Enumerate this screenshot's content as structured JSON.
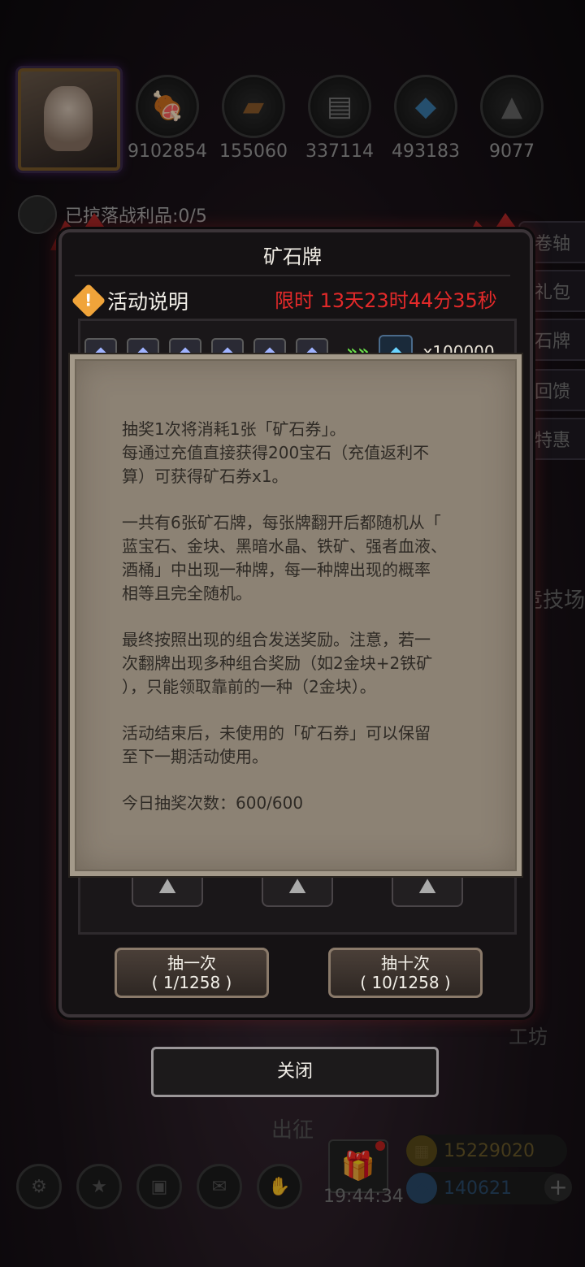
{
  "resources": [
    {
      "icon": "meat-icon",
      "value": "9102854"
    },
    {
      "icon": "wood-icon",
      "value": "155060"
    },
    {
      "icon": "iron-icon",
      "value": "337114"
    },
    {
      "icon": "crystal-icon",
      "value": "493183"
    },
    {
      "icon": "stone-icon",
      "value": "9077"
    }
  ],
  "loot_text": "已掠落战利品:0/5",
  "side_buttons": [
    "卷轴",
    "礼包",
    "石牌",
    "回馈",
    "特惠"
  ],
  "arena_label": "竞技场",
  "workshop_label": "工坊",
  "expedition_label": "出征",
  "panel": {
    "title": "矿石牌",
    "info_label": "活动说明",
    "timer": "限时 13天23时44分35秒",
    "gem_count": "x100000",
    "draw_one": {
      "line1": "抽一次",
      "line2": "( 1/1258 )"
    },
    "draw_ten": {
      "line1": "抽十次",
      "line2": "( 10/1258 )"
    }
  },
  "description": {
    "p1_l1": "抽奖1次将消耗1张「矿石券」。",
    "p1_l2": "每通过充值直接获得200宝石（充值返利不",
    "p1_l3": "算）可获得矿石券x1。",
    "p2_l1": "一共有6张矿石牌，每张牌翻开后都随机从「",
    "p2_l2": "蓝宝石、金块、黑暗水晶、铁矿、强者血液、",
    "p2_l3": "酒桶」中出现一种牌，每一种牌出现的概率",
    "p2_l4": "相等且完全随机。",
    "p3_l1": "最终按照出现的组合发送奖励。注意，若一",
    "p3_l2": "次翻牌出现多种组合奖励（如2金块+2铁矿",
    "p3_l3": "），只能领取靠前的一种（2金块）。",
    "p4_l1": "活动结束后，未使用的「矿石券」可以保留",
    "p4_l2": "至下一期活动使用。",
    "p5": "今日抽奖次数：600/600"
  },
  "close_label": "关闭",
  "clock": "19:44:34",
  "gold": "15229020",
  "gems": "140621"
}
